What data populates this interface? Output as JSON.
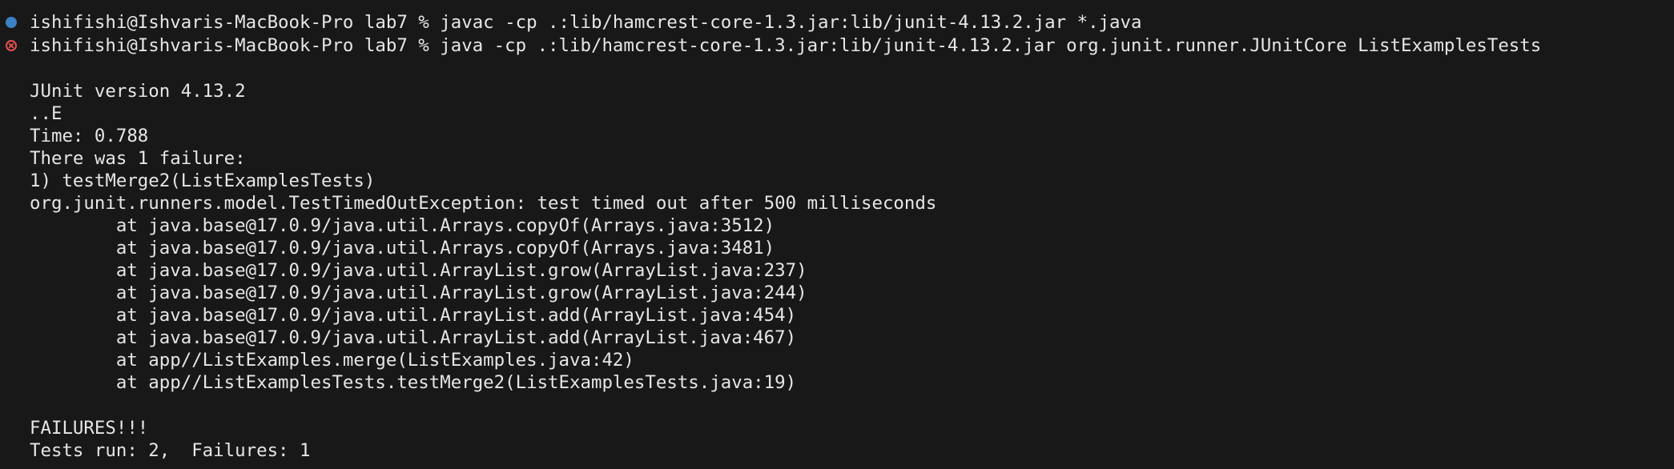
{
  "terminal": {
    "commands": [
      {
        "status": "success",
        "status_icon": "blue-dot-icon",
        "text": "ishifishi@Ishvaris-MacBook-Pro lab7 % javac -cp .:lib/hamcrest-core-1.3.jar:lib/junit-4.13.2.jar *.java"
      },
      {
        "status": "error",
        "status_icon": "error-circle-icon",
        "text": "ishifishi@Ishvaris-MacBook-Pro lab7 % java -cp .:lib/hamcrest-core-1.3.jar:lib/junit-4.13.2.jar org.junit.runner.JUnitCore ListExamplesTests"
      }
    ],
    "output": {
      "version": "JUnit version 4.13.2",
      "progress": "..E",
      "time": "Time: 0.788",
      "failure_summary": "There was 1 failure:",
      "failure_title": "1) testMerge2(ListExamplesTests)",
      "exception": "org.junit.runners.model.TestTimedOutException: test timed out after 500 milliseconds",
      "stack_trace": [
        "        at java.base@17.0.9/java.util.Arrays.copyOf(Arrays.java:3512)",
        "        at java.base@17.0.9/java.util.Arrays.copyOf(Arrays.java:3481)",
        "        at java.base@17.0.9/java.util.ArrayList.grow(ArrayList.java:237)",
        "        at java.base@17.0.9/java.util.ArrayList.grow(ArrayList.java:244)",
        "        at java.base@17.0.9/java.util.ArrayList.add(ArrayList.java:454)",
        "        at java.base@17.0.9/java.util.ArrayList.add(ArrayList.java:467)",
        "        at app//ListExamples.merge(ListExamples.java:42)",
        "        at app//ListExamplesTests.testMerge2(ListExamplesTests.java:19)"
      ],
      "failures_banner": "FAILURES!!!",
      "result_line": "Tests run: 2,  Failures: 1"
    }
  },
  "colors": {
    "background": "#181818",
    "text": "#e6e6e6",
    "success_marker": "#3b82c4",
    "error_marker": "#e05252"
  }
}
